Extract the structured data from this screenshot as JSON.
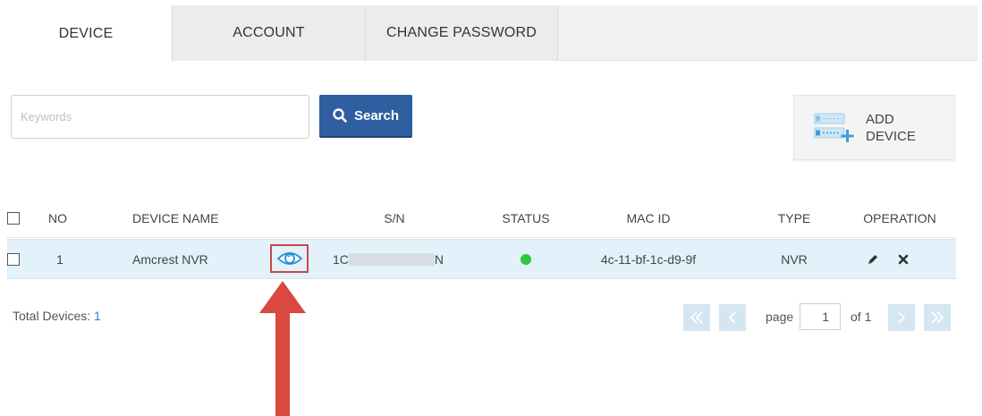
{
  "tabs": [
    {
      "label": "DEVICE",
      "active": true
    },
    {
      "label": "ACCOUNT",
      "active": false
    },
    {
      "label": "CHANGE PASSWORD",
      "active": false
    }
  ],
  "search": {
    "placeholder": "Keywords",
    "button_label": "Search",
    "icon": "search-icon"
  },
  "add_device": {
    "label": "ADD\nDEVICE",
    "icon": "add-device-icon"
  },
  "table": {
    "headers": [
      "NO",
      "DEVICE NAME",
      "S/N",
      "STATUS",
      "MAC ID",
      "TYPE",
      "OPERATION"
    ],
    "rows": [
      {
        "no": "1",
        "device_name": "Amcrest NVR",
        "sn_prefix": "1C",
        "sn_suffix": "N",
        "status": "online",
        "mac_id": "4c-11-bf-1c-d9-9f",
        "type": "NVR"
      }
    ]
  },
  "footer": {
    "total_label": "Total Devices:",
    "total_count": "1"
  },
  "pagination": {
    "page_label": "page",
    "current_page": "1",
    "of_label": "of 1"
  },
  "colors": {
    "primary": "#2f5ea1",
    "status_online": "#2fc83c",
    "highlight": "#c8484a",
    "row_bg": "#e3f1fa"
  }
}
